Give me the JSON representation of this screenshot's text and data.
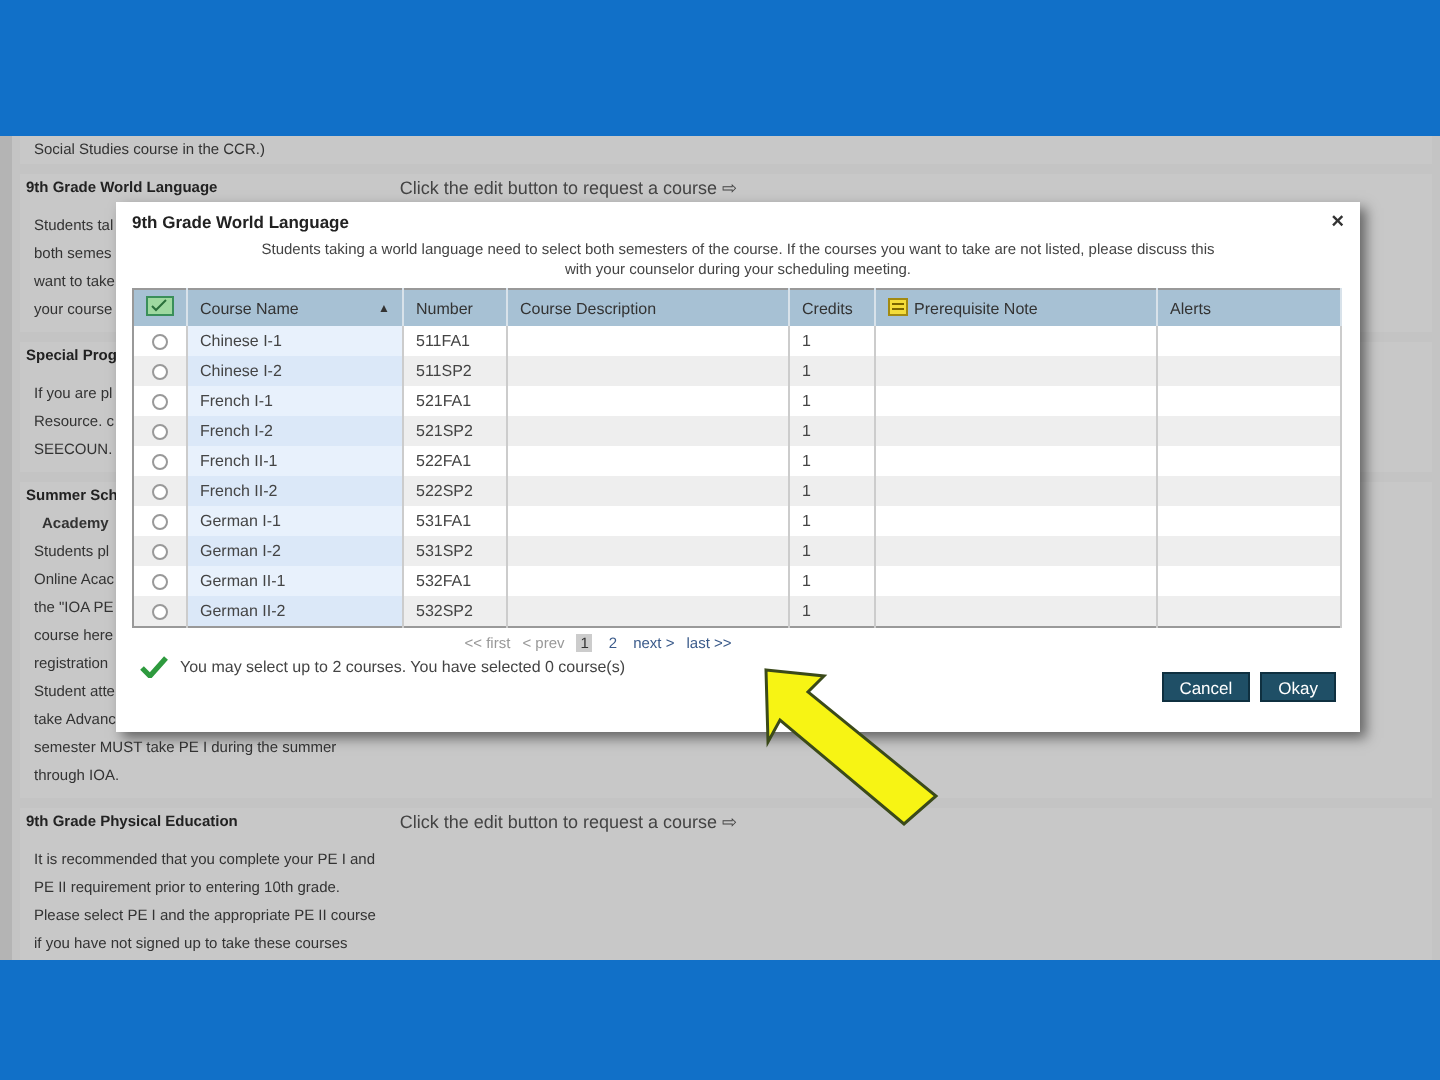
{
  "page": {
    "intro_line": "Social Studies course in the CCR.)",
    "sections": [
      {
        "title": "9th Grade World Language",
        "hint": "Click the edit button to request a course ⇨",
        "lines": [
          "Students tal",
          "both semes",
          "want to take",
          "your course"
        ]
      },
      {
        "title": "Special Prog",
        "lines": [
          "If you are pl",
          "Resource. c",
          "SEECOUN."
        ]
      },
      {
        "title": "Summer Sch",
        "subtitle": "Academy",
        "lines": [
          "Students pl",
          "Online Acac",
          "the \"IOA PE",
          "course here",
          "registration",
          "Student atte",
          "take Advanc",
          "semester MUST take PE I during the summer",
          "through IOA."
        ]
      },
      {
        "title": "9th Grade Physical Education",
        "hint": "Click the edit button to request a course ⇨",
        "lines": [
          "It is recommended that you complete your PE I and",
          "PE II requirement prior to entering 10th grade.",
          "Please select PE I and the appropriate PE II course",
          "if you have not signed up to take these courses"
        ]
      }
    ]
  },
  "dialog": {
    "title": "9th Grade World Language",
    "close": "×",
    "intro": "Students taking a world language need to select both semesters of the course. If the courses you want to take are not listed, please discuss this with your counselor during your scheduling meeting.",
    "table": {
      "columns": [
        "Course Name",
        "Number",
        "Course Description",
        "Credits",
        "Prerequisite Note",
        "Alerts"
      ],
      "sort_indicator": "▲",
      "rows": [
        {
          "selected": false,
          "cells": [
            "Chinese I-1",
            "511FA1",
            "",
            "1",
            "",
            ""
          ]
        },
        {
          "selected": false,
          "cells": [
            "Chinese I-2",
            "511SP2",
            "",
            "1",
            "",
            ""
          ]
        },
        {
          "selected": false,
          "cells": [
            "French I-1",
            "521FA1",
            "",
            "1",
            "",
            ""
          ]
        },
        {
          "selected": false,
          "cells": [
            "French I-2",
            "521SP2",
            "",
            "1",
            "",
            ""
          ]
        },
        {
          "selected": false,
          "cells": [
            "French II-1",
            "522FA1",
            "",
            "1",
            "",
            ""
          ]
        },
        {
          "selected": false,
          "cells": [
            "French II-2",
            "522SP2",
            "",
            "1",
            "",
            ""
          ]
        },
        {
          "selected": false,
          "cells": [
            "German I-1",
            "531FA1",
            "",
            "1",
            "",
            ""
          ]
        },
        {
          "selected": false,
          "cells": [
            "German I-2",
            "531SP2",
            "",
            "1",
            "",
            ""
          ]
        },
        {
          "selected": false,
          "cells": [
            "German II-1",
            "532FA1",
            "",
            "1",
            "",
            ""
          ]
        },
        {
          "selected": false,
          "cells": [
            "German II-2",
            "532SP2",
            "",
            "1",
            "",
            ""
          ]
        }
      ]
    },
    "pagination": {
      "first": "<< first",
      "prev": "< prev",
      "pages": [
        {
          "label": "1",
          "selected": true
        },
        {
          "label": "2",
          "selected": false
        }
      ],
      "next": "next >",
      "last": "last >>"
    },
    "message": "You may select up to 2 courses.  You have selected 0 course(s)",
    "buttons": [
      "Cancel",
      "Okay"
    ]
  }
}
